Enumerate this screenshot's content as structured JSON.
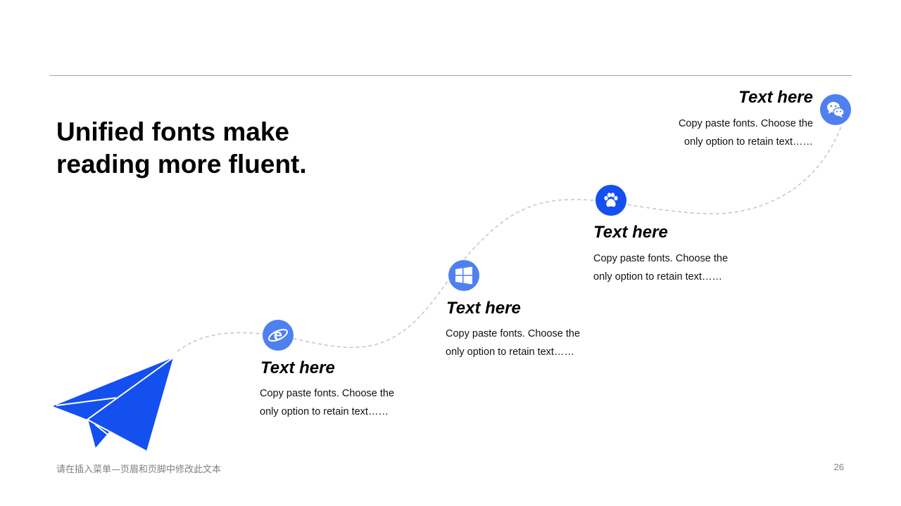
{
  "slide": {
    "title_line1": "Unified fonts make",
    "title_line2": "reading more fluent.",
    "footer_note": "请在插入菜单—页眉和页脚中修改此文本",
    "page_number": "26"
  },
  "colors": {
    "accent_blue": "#1450f0",
    "icon_blue": "#4f80f0",
    "path_gray": "#c4c4c4",
    "rule_gray": "#a6a6a6"
  },
  "steps": [
    {
      "icon": "internet-explorer-icon",
      "heading": "Text here",
      "body_line1": "Copy paste fonts. Choose the",
      "body_line2": "only option to retain text……"
    },
    {
      "icon": "windows-icon",
      "heading": "Text here",
      "body_line1": "Copy paste fonts. Choose the",
      "body_line2": "only option to retain text……"
    },
    {
      "icon": "paw-icon",
      "heading": "Text here",
      "body_line1": "Copy paste fonts. Choose the",
      "body_line2": "only option to retain text……"
    },
    {
      "icon": "wechat-icon",
      "heading": "Text here",
      "body_line1": "Copy paste fonts. Choose the",
      "body_line2": "only option to retain text……"
    }
  ]
}
